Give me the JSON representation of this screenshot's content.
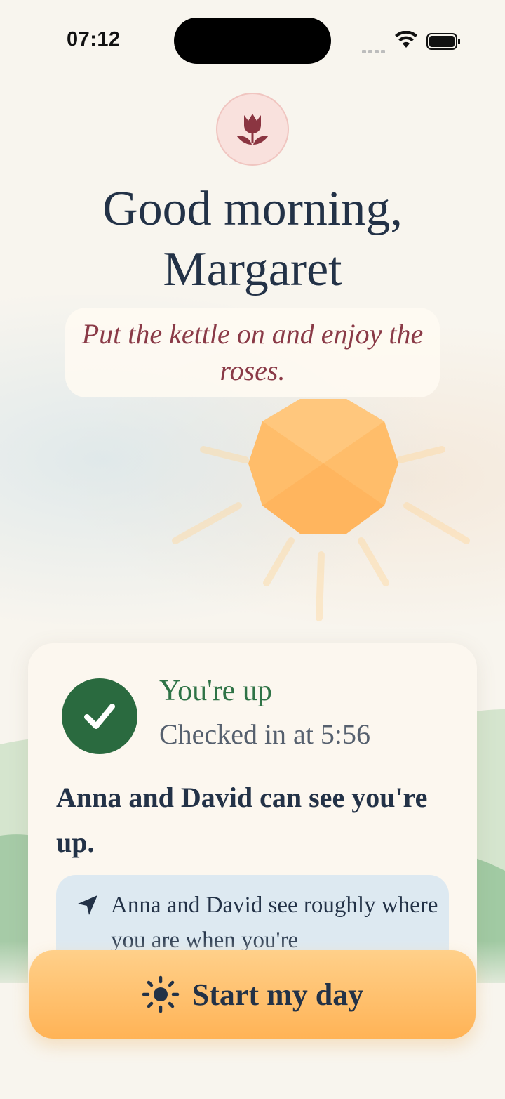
{
  "status_bar": {
    "time": "07:12"
  },
  "header": {
    "greeting_line1": "Good morning,",
    "greeting_line2": "Margaret",
    "motto": "Put the kettle on and enjoy the roses."
  },
  "card": {
    "status_title": "You're up",
    "status_subtitle": "Checked in at 5:56",
    "visible_note": "Anna and David can see you're up.",
    "info_text": "Anna and David see roughly where you are when you're"
  },
  "cta": {
    "label": "Start my day",
    "icon": "sun-icon"
  },
  "icons": {
    "logo": "tulip-icon",
    "check": "checkmark-icon",
    "info": "location-arrow-icon"
  },
  "colors": {
    "accent_green": "#2a6a3f",
    "motto_red": "#8a3a47",
    "cta_orange": "#ffb356",
    "text_navy": "#233247"
  }
}
